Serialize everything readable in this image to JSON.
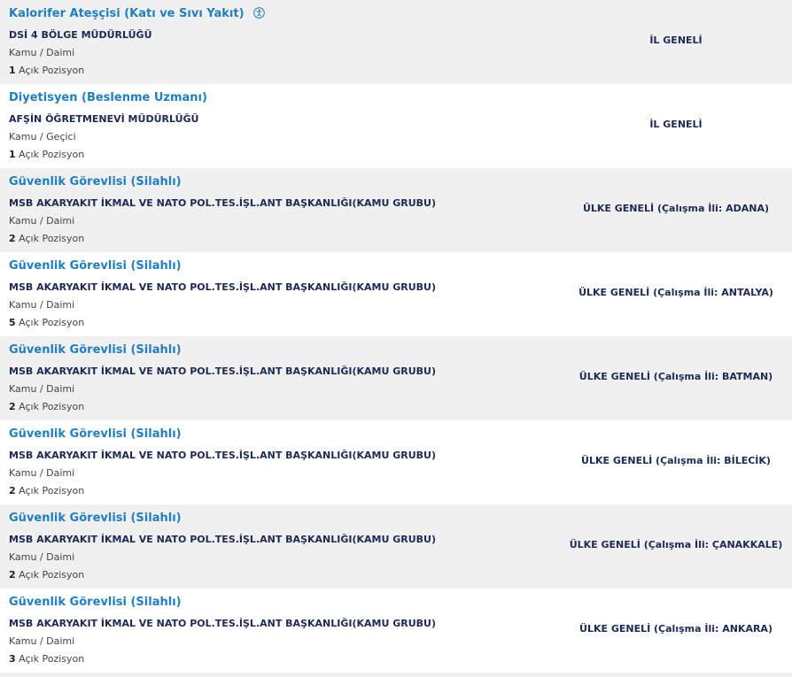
{
  "listings": [
    {
      "title": "Kalorifer Ateşçisi (Katı ve Sıvı Yakıt)",
      "has_icon": true,
      "org": "DSİ 4 BÖLGE MÜDÜRLÜĞÜ",
      "type": "Kamu / Daimi",
      "count": "1",
      "positions_label": "Açık Pozisyon",
      "region": "İL GENELİ"
    },
    {
      "title": "Diyetisyen (Beslenme Uzmanı)",
      "has_icon": false,
      "org": "AFŞİN ÖĞRETMENEVİ MÜDÜRLÜĞÜ",
      "type": "Kamu / Geçici",
      "count": "1",
      "positions_label": "Açık Pozisyon",
      "region": "İL GENELİ"
    },
    {
      "title": "Güvenlik Görevlisi (Silahlı)",
      "has_icon": false,
      "org": "MSB AKARYAKIT İKMAL VE NATO POL.TES.İŞL.ANT BAŞKANLIĞI(KAMU GRUBU)",
      "type": "Kamu / Daimi",
      "count": "2",
      "positions_label": "Açık Pozisyon",
      "region": "ÜLKE GENELİ (Çalışma İli: ADANA)"
    },
    {
      "title": "Güvenlik Görevlisi (Silahlı)",
      "has_icon": false,
      "org": "MSB AKARYAKIT İKMAL VE NATO POL.TES.İŞL.ANT BAŞKANLIĞI(KAMU GRUBU)",
      "type": "Kamu / Daimi",
      "count": "5",
      "positions_label": "Açık Pozisyon",
      "region": "ÜLKE GENELİ (Çalışma İli: ANTALYA)"
    },
    {
      "title": "Güvenlik Görevlisi (Silahlı)",
      "has_icon": false,
      "org": "MSB AKARYAKIT İKMAL VE NATO POL.TES.İŞL.ANT BAŞKANLIĞI(KAMU GRUBU)",
      "type": "Kamu / Daimi",
      "count": "2",
      "positions_label": "Açık Pozisyon",
      "region": "ÜLKE GENELİ (Çalışma İli: BATMAN)"
    },
    {
      "title": "Güvenlik Görevlisi (Silahlı)",
      "has_icon": false,
      "org": "MSB AKARYAKIT İKMAL VE NATO POL.TES.İŞL.ANT BAŞKANLIĞI(KAMU GRUBU)",
      "type": "Kamu / Daimi",
      "count": "2",
      "positions_label": "Açık Pozisyon",
      "region": "ÜLKE GENELİ (Çalışma İli: BİLECİK)"
    },
    {
      "title": "Güvenlik Görevlisi (Silahlı)",
      "has_icon": false,
      "org": "MSB AKARYAKIT İKMAL VE NATO POL.TES.İŞL.ANT BAŞKANLIĞI(KAMU GRUBU)",
      "type": "Kamu / Daimi",
      "count": "2",
      "positions_label": "Açık Pozisyon",
      "region": "ÜLKE GENELİ (Çalışma İli: ÇANAKKALE)"
    },
    {
      "title": "Güvenlik Görevlisi (Silahlı)",
      "has_icon": false,
      "org": "MSB AKARYAKIT İKMAL VE NATO POL.TES.İŞL.ANT BAŞKANLIĞI(KAMU GRUBU)",
      "type": "Kamu / Daimi",
      "count": "3",
      "positions_label": "Açık Pozisyon",
      "region": "ÜLKE GENELİ (Çalışma İli: ANKARA)"
    }
  ],
  "colors": {
    "title_link": "#1f7fc0",
    "org_text": "#1e2a55",
    "row_alt_bg": "#f0f0f0"
  },
  "icons": {
    "title_icon": "accessibility-icon"
  }
}
